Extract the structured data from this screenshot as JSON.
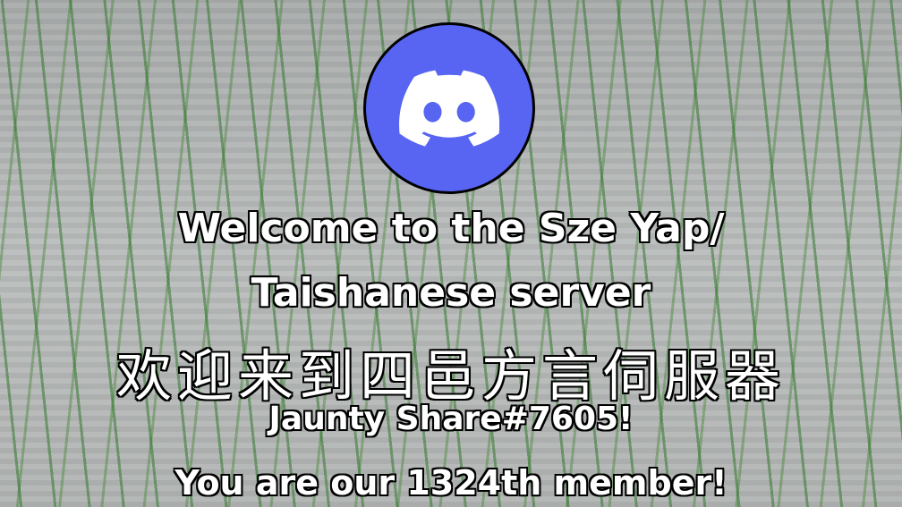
{
  "card": {
    "title_line1": "Welcome to the Sze Yap/",
    "title_line2": "Taishanese server",
    "title_chinese": "欢迎来到四邑方言伺服器",
    "username": "Jaunty Share#7605!",
    "member_message": "You are our 1324th member!",
    "logo_icon": "discord-logo-icon",
    "colors": {
      "logo_bg": "#5865f2",
      "text": "#ffffff",
      "outline": "#000000"
    }
  }
}
